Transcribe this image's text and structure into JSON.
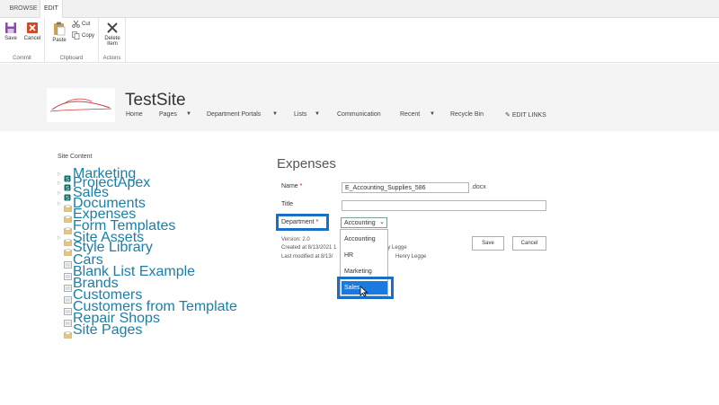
{
  "ribbon": {
    "tabs": [
      "BROWSE",
      "EDIT"
    ],
    "groups": [
      {
        "label": "Commit",
        "buttons": [
          "Save",
          "Cancel"
        ]
      },
      {
        "label": "Clipboard",
        "buttons": [
          "Paste",
          "Cut",
          "Copy"
        ]
      },
      {
        "label": "Actions",
        "buttons": [
          "Delete Item"
        ]
      }
    ]
  },
  "site": {
    "title": "TestSite",
    "nav": [
      "Home",
      "Pages",
      "Department Portals",
      "Lists",
      "Communication",
      "Recent",
      "Recycle Bin"
    ],
    "edit_links": "EDIT LINKS"
  },
  "leftnav": {
    "title": "Site Content",
    "items": [
      "Marketing",
      "ProjectApex",
      "Sales",
      "Documents",
      "Expenses",
      "Form Templates",
      "Site Assets",
      "Style Library",
      "Cars",
      "Blank List Example",
      "Brands",
      "Customers",
      "Customers from Template",
      "Repair Shops",
      "Site Pages"
    ]
  },
  "form": {
    "heading": "Expenses",
    "name_label": "Name",
    "name_value": "E_Accounting_Supplies_586",
    "name_ext": ".docx",
    "title_label": "Title",
    "title_value": "",
    "department_label": "Department",
    "required_mark": "*",
    "department_value": "Accounting",
    "options": [
      "Accounting",
      "HR",
      "Marketing",
      "Sales"
    ],
    "selected_option": "Sales",
    "version": "Version: 2.0",
    "created": "Created at 8/13/2021 1",
    "created_by": "nry Legge",
    "modified": "Last modified at 8/13/",
    "modified_by": "Henry Legge",
    "save_label": "Save",
    "cancel_label": "Cancel"
  },
  "colors": {
    "accent": "#1a6fc4",
    "link": "#1a7fa8",
    "selected": "#1a7ae0"
  }
}
